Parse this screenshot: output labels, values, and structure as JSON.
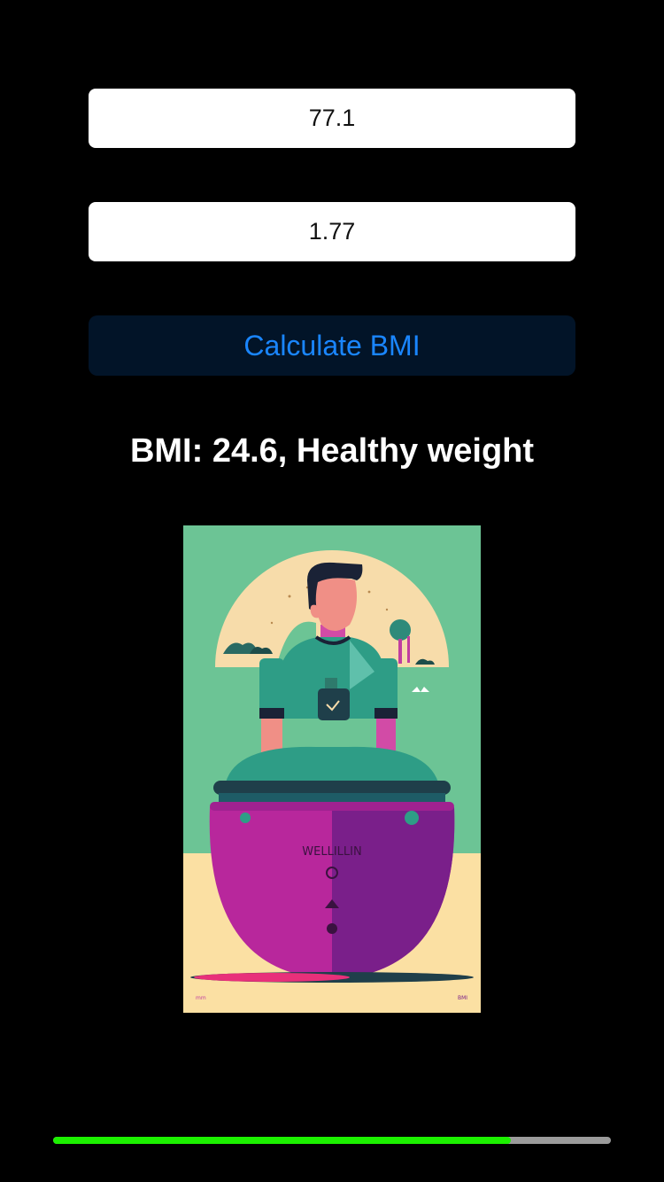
{
  "form": {
    "weight_value": "77.1",
    "height_value": "1.77",
    "calculate_label": "Calculate BMI"
  },
  "result": {
    "text": "BMI: 24.6, Healthy weight"
  },
  "illustration": {
    "description_icon": "person-in-pot-illustration",
    "pot_text": "WELLILLIN",
    "corner_left": "mm",
    "corner_right": "BMI"
  },
  "progress": {
    "fraction": 0.82,
    "fill_color": "#1cf000",
    "track_color": "#9b9b9b"
  },
  "colors": {
    "background": "#000000",
    "button_bg": "#021428",
    "button_text": "#1a86ff",
    "result_text": "#ffffff"
  }
}
